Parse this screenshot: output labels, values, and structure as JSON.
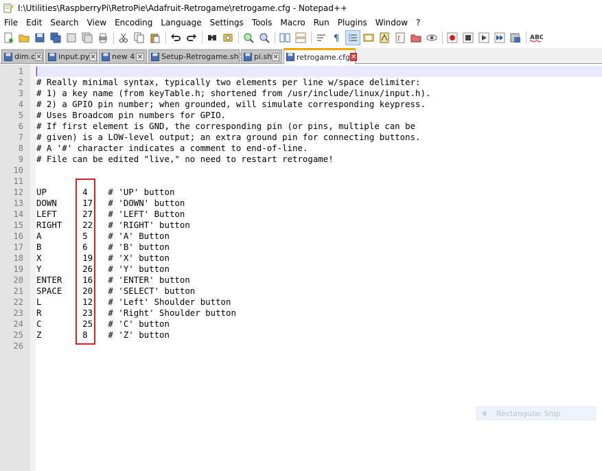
{
  "window": {
    "title": "I:\\Utilities\\RaspberryPi\\RetroPie\\Adafruit-Retrogame\\retrogame.cfg - Notepad++"
  },
  "menu": [
    "File",
    "Edit",
    "Search",
    "View",
    "Encoding",
    "Language",
    "Settings",
    "Tools",
    "Macro",
    "Run",
    "Plugins",
    "Window",
    "?"
  ],
  "toolbar": {
    "spellcheck_label": "ABC"
  },
  "tabs": [
    {
      "label": "dim.c",
      "active": false
    },
    {
      "label": "input.py",
      "active": false
    },
    {
      "label": "new 4",
      "active": false
    },
    {
      "label": "Setup-Retrogame.sh",
      "active": false
    },
    {
      "label": "pi.sh",
      "active": false
    },
    {
      "label": "retrogame.cfg",
      "active": true
    }
  ],
  "editor": {
    "lines": [
      "",
      "# Really minimal syntax, typically two elements per line w/space delimiter:",
      "# 1) a key name (from keyTable.h; shortened from /usr/include/linux/input.h).",
      "# 2) a GPIO pin number; when grounded, will simulate corresponding keypress.",
      "# Uses Broadcom pin numbers for GPIO.",
      "# If first element is GND, the corresponding pin (or pins, multiple can be",
      "# given) is a LOW-level output; an extra ground pin for connecting buttons.",
      "# A '#' character indicates a comment to end-of-line.",
      "# File can be edited \"live,\" no need to restart retrogame!",
      "",
      "",
      "UP       4    # 'UP' button",
      "DOWN     17   # 'DOWN' button",
      "LEFT     27   # 'LEFT' Button",
      "RIGHT    22   # 'RIGHT' button",
      "A        5    # 'A' Button",
      "B        6    # 'B' button",
      "X        19   # 'X' button",
      "Y        26   # 'Y' button",
      "ENTER    16   # 'ENTER' button",
      "SPACE    20   # 'SELECT' button",
      "L        12   # 'Left' Shoulder button",
      "R        23   # 'Right' Shoulder button",
      "C        25   # 'C' button",
      "Z        8    # 'Z' button",
      ""
    ],
    "line_numbers": [
      "1",
      "2",
      "3",
      "4",
      "5",
      "6",
      "7",
      "8",
      "9",
      "10",
      "11",
      "12",
      "13",
      "14",
      "15",
      "16",
      "17",
      "18",
      "19",
      "20",
      "21",
      "22",
      "23",
      "24",
      "25",
      "26"
    ]
  },
  "overlay": {
    "snip_label": "Rectangular Snip"
  }
}
